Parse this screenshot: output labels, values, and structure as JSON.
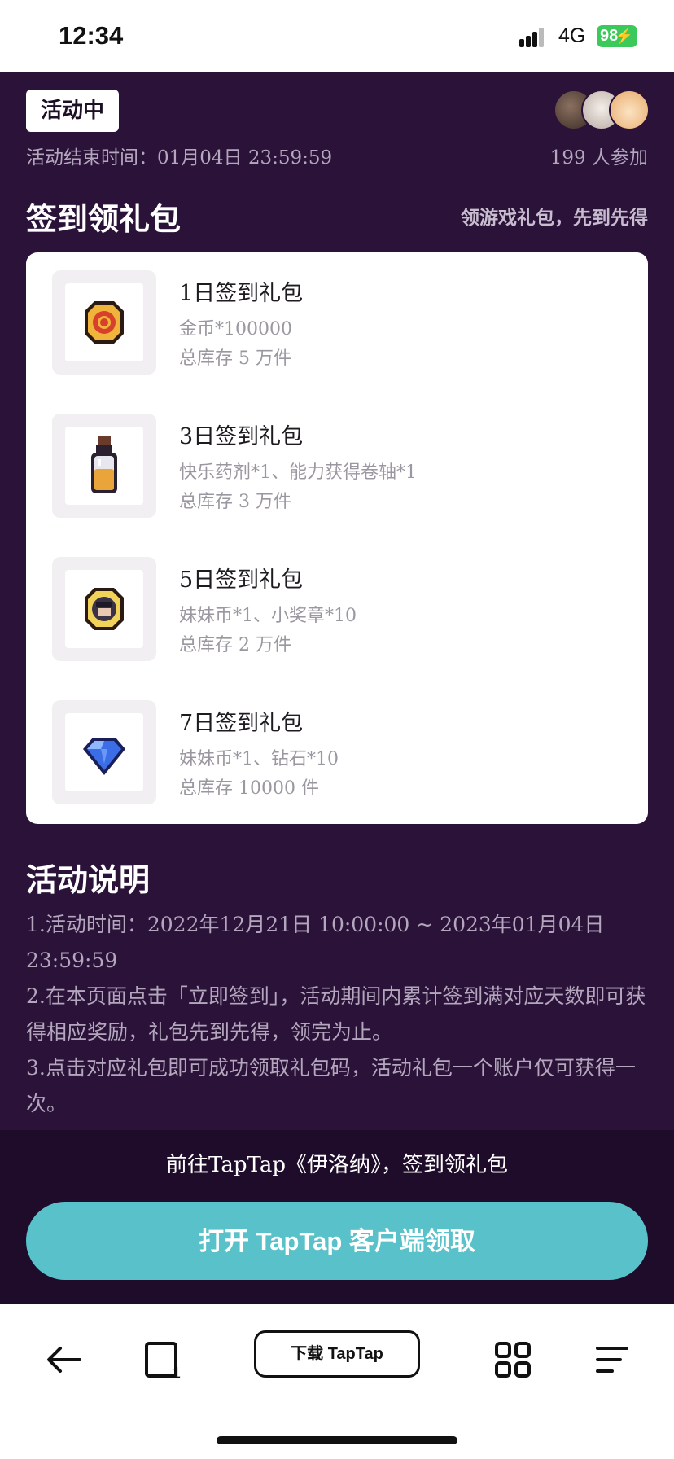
{
  "status_bar": {
    "time": "12:34",
    "network": "4G",
    "battery": "98"
  },
  "header": {
    "status_badge": "活动中",
    "end_time": "活动结束时间：01月04日 23:59:59",
    "participants": "199 人参加"
  },
  "section": {
    "title": "签到领礼包",
    "subtitle": "领游戏礼包，先到先得"
  },
  "gifts": [
    {
      "title": "1日签到礼包",
      "content": "金币*100000",
      "stock": "总库存 5 万件",
      "icon": "gold-coin-icon"
    },
    {
      "title": "3日签到礼包",
      "content": "快乐药剂*1、能力获得卷轴*1",
      "stock": "总库存 3 万件",
      "icon": "potion-bottle-icon"
    },
    {
      "title": "5日签到礼包",
      "content": "妹妹币*1、小奖章*10",
      "stock": "总库存 2 万件",
      "icon": "medal-coin-icon"
    },
    {
      "title": "7日签到礼包",
      "content": "妹妹币*1、钻石*10",
      "stock": "总库存 10000 件",
      "icon": "diamond-icon"
    }
  ],
  "description": {
    "title": "活动说明",
    "lines": [
      "1.活动时间：2022年12月21日 10:00:00 ~ 2023年01月04日 23:59:59",
      "2.在本页面点击「立即签到」，活动期间内累计签到满对应天数即可获得相应奖励，礼包先到先得，领完为止。",
      "3.点击对应礼包即可成功领取礼包码，活动礼包一个账户仅可获得一次。"
    ]
  },
  "cta": {
    "hint": "前往TapTap《伊洛纳》，签到领礼包",
    "button_label": "打开 TapTap 客户端领取"
  },
  "browser_bar": {
    "download_label": "下载 TapTap"
  },
  "colors": {
    "page_bg": "#2a1238",
    "accent": "#58c1c9",
    "card_bg": "#ffffff"
  }
}
